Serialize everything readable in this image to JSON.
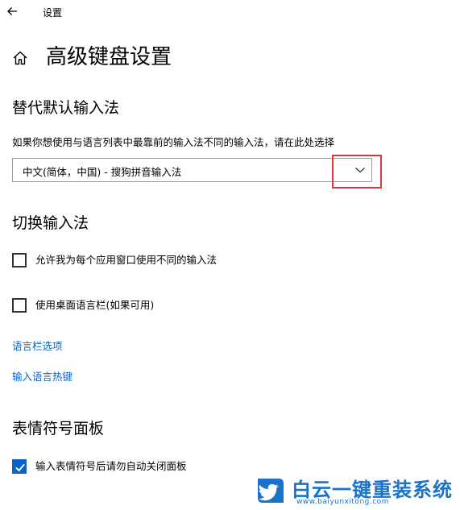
{
  "window": {
    "title": "设置",
    "back_icon": "arrow-left-icon"
  },
  "page": {
    "home_icon": "home-icon",
    "title": "高级键盘设置"
  },
  "override_default_input": {
    "title": "替代默认输入法",
    "description": "如果你想使用与语言列表中最靠前的输入法不同的输入法，请在此处选择",
    "dropdown": {
      "selected": "中文(简体，中国) - 搜狗拼音输入法",
      "icon": "chevron-down-icon"
    },
    "highlight_color": "#d9363e"
  },
  "switch_input": {
    "title": "切换输入法",
    "options": [
      {
        "label": "允许我为每个应用窗口使用不同的输入法",
        "checked": false
      },
      {
        "label": "使用桌面语言栏(如果可用)",
        "checked": false
      }
    ],
    "links": [
      {
        "label": "语言栏选项"
      },
      {
        "label": "输入语言热键"
      }
    ]
  },
  "emoji_panel": {
    "title": "表情符号面板",
    "options": [
      {
        "label": "输入表情符号后请勿自动关闭面板",
        "checked": true
      }
    ]
  },
  "watermark": {
    "text": "白云一键重装系统",
    "url": "www.baiyunxitong.com",
    "icon": "twitter-bird-icon"
  },
  "colors": {
    "accent": "#0a63c9",
    "link": "#0a63c9",
    "watermark": "#1a73c8"
  }
}
